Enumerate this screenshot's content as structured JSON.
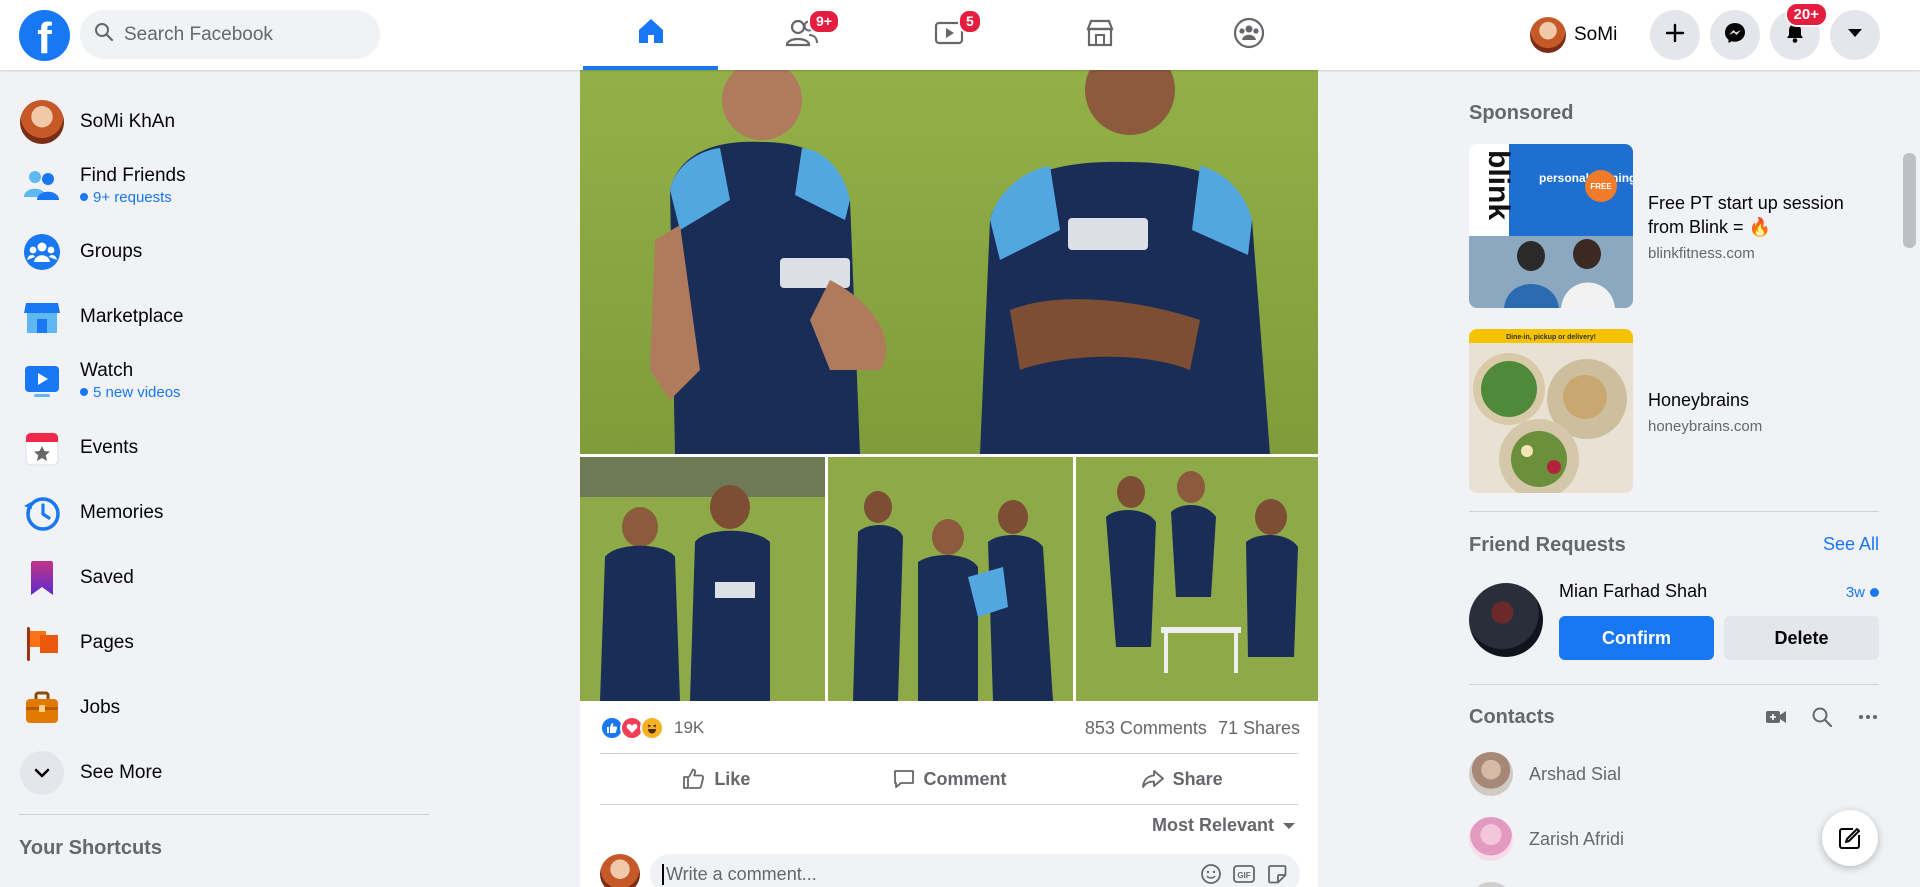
{
  "header": {
    "logo_letter": "f",
    "search_placeholder": "Search Facebook",
    "tabs": [
      {
        "name": "home",
        "badge": ""
      },
      {
        "name": "friends",
        "badge": "9+"
      },
      {
        "name": "watch",
        "badge": "5"
      },
      {
        "name": "marketplace",
        "badge": ""
      },
      {
        "name": "groups",
        "badge": ""
      }
    ],
    "profile_name": "SoMi",
    "notifications_badge": "20+",
    "accent_color": "#1877f2"
  },
  "left_nav": {
    "items": [
      {
        "label": "SoMi KhAn",
        "sub": ""
      },
      {
        "label": "Find Friends",
        "sub": "9+ requests"
      },
      {
        "label": "Groups",
        "sub": ""
      },
      {
        "label": "Marketplace",
        "sub": ""
      },
      {
        "label": "Watch",
        "sub": "5 new videos"
      },
      {
        "label": "Events",
        "sub": ""
      },
      {
        "label": "Memories",
        "sub": ""
      },
      {
        "label": "Saved",
        "sub": ""
      },
      {
        "label": "Pages",
        "sub": ""
      },
      {
        "label": "Jobs",
        "sub": ""
      },
      {
        "label": "See More",
        "sub": ""
      }
    ],
    "shortcuts_title": "Your Shortcuts"
  },
  "post": {
    "reaction_count": "19K",
    "comments": "853 Comments",
    "shares": "71 Shares",
    "actions": {
      "like": "Like",
      "comment": "Comment",
      "share": "Share"
    },
    "sort_label": "Most Relevant",
    "comment_placeholder": "Write a comment..."
  },
  "right_col": {
    "sponsored_title": "Sponsored",
    "ads": [
      {
        "title": "Free PT start up session from Blink = 🔥",
        "url": "blinkfitness.com",
        "img_text_brand": "blink",
        "img_text_banner": "personal training",
        "img_text_badge": "FREE"
      },
      {
        "title": "Honeybrains",
        "url": "honeybrains.com",
        "img_text_banner": "Dine-in, pickup or delivery!"
      }
    ],
    "friend_requests_title": "Friend Requests",
    "see_all": "See All",
    "request": {
      "name": "Mian Farhad Shah",
      "time": "3w",
      "confirm": "Confirm",
      "delete": "Delete"
    },
    "contacts_title": "Contacts",
    "contacts": [
      {
        "name": "Arshad Sial"
      },
      {
        "name": "Zarish Afridi"
      }
    ]
  }
}
